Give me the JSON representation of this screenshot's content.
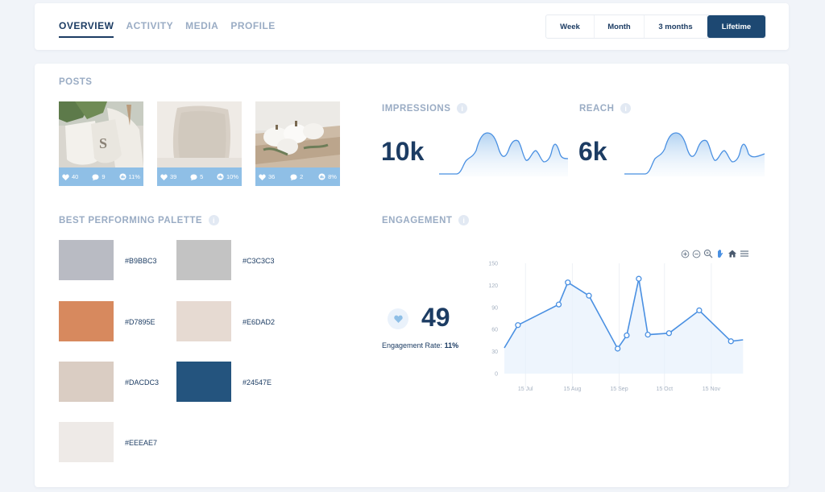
{
  "tabs": [
    {
      "label": "OVERVIEW",
      "active": true
    },
    {
      "label": "ACTIVITY",
      "active": false
    },
    {
      "label": "MEDIA",
      "active": false
    },
    {
      "label": "PROFILE",
      "active": false
    }
  ],
  "periods": [
    {
      "label": "Week",
      "active": false
    },
    {
      "label": "Month",
      "active": false
    },
    {
      "label": "3 months",
      "active": false
    },
    {
      "label": "Lifetime",
      "active": true
    }
  ],
  "posts": {
    "title": "POSTS",
    "items": [
      {
        "likes": "40",
        "comments": "9",
        "rate": "11%"
      },
      {
        "likes": "39",
        "comments": "5",
        "rate": "10%"
      },
      {
        "likes": "36",
        "comments": "2",
        "rate": "8%"
      }
    ]
  },
  "impressions": {
    "title": "IMPRESSIONS",
    "value": "10k"
  },
  "reach": {
    "title": "REACH",
    "value": "6k"
  },
  "palette": {
    "title": "BEST PERFORMING PALETTE",
    "colors": [
      "#B9BBC3",
      "#C3C3C3",
      "#D7895E",
      "#E6DAD2",
      "#DACDC3",
      "#24547E",
      "#EEEAE7"
    ]
  },
  "engagement": {
    "title": "ENGAGEMENT",
    "value": "49",
    "rate_label": "Engagement Rate:",
    "rate_value": "11%"
  },
  "chart_data": {
    "type": "area",
    "title": "",
    "xlabel": "",
    "ylabel": "",
    "ylim": [
      0,
      150
    ],
    "yticks": [
      0,
      30,
      60,
      90,
      120,
      150
    ],
    "xticks": [
      "15 Jul",
      "15 Aug",
      "15 Sep",
      "15 Oct",
      "15 Nov"
    ],
    "grid": true,
    "series": [
      {
        "x": [
          "2023-07-01",
          "2023-07-10",
          "2023-08-06",
          "2023-08-12",
          "2023-08-26",
          "2023-09-14",
          "2023-09-20",
          "2023-09-28",
          "2023-10-04",
          "2023-10-18",
          "2023-11-07",
          "2023-11-28",
          "2023-12-06"
        ],
        "values": [
          35,
          66,
          94,
          124,
          106,
          34,
          52,
          129,
          53,
          55,
          86,
          44,
          46
        ],
        "color": "#4a90e2"
      }
    ]
  },
  "colors": {
    "accent": "#1d4872",
    "line": "#4a90e2",
    "muted": "#9aacc4",
    "post_bar": "#8fbfe6"
  }
}
